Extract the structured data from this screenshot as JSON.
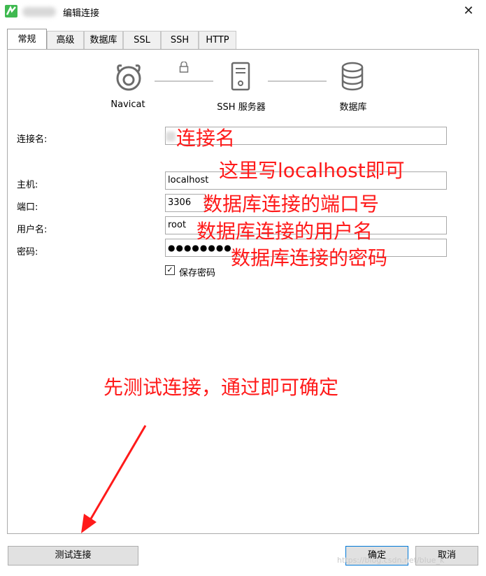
{
  "window": {
    "title": "编辑连接",
    "close_glyph": "✕"
  },
  "tabs": [
    "常规",
    "高级",
    "数据库",
    "SSL",
    "SSH",
    "HTTP"
  ],
  "diagram": {
    "navicat_label": "Navicat",
    "ssh_label": "SSH 服务器",
    "db_label": "数据库",
    "icons": [
      "navicat-logo-icon",
      "lock-icon",
      "server-icon",
      "database-icon"
    ]
  },
  "form": {
    "connection_name_label": "连接名:",
    "connection_name_value": "",
    "host_label": "主机:",
    "host_value": "localhost",
    "port_label": "端口:",
    "port_value": "3306",
    "user_label": "用户名:",
    "user_value": "root",
    "password_label": "密码:",
    "password_mask": "●●●●●●●●",
    "save_password_label": "保存密码",
    "save_password_checked": true
  },
  "annotations": {
    "conn_name": "连接名",
    "host": "这里写localhost即可",
    "port": "数据库连接的端口号",
    "user": "数据库连接的用户名",
    "password": "数据库连接的密码",
    "instruction": "先测试连接，通过即可确定",
    "color": "#ff1a1a"
  },
  "buttons": {
    "test": "测试连接",
    "ok": "确定",
    "cancel": "取消"
  },
  "watermark": "https://blog.csdn.net/blue_k"
}
